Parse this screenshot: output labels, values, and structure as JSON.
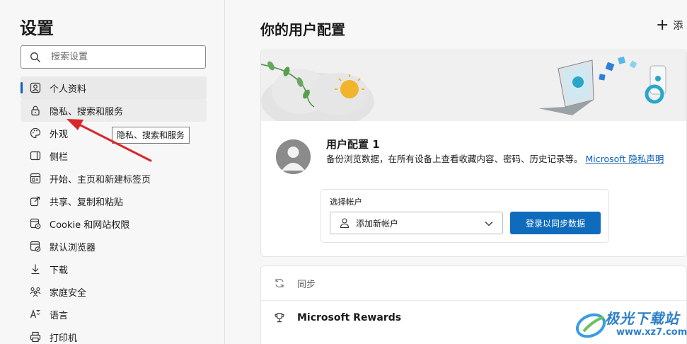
{
  "sidebar": {
    "title": "设置",
    "search_placeholder": "搜索设置",
    "items": [
      {
        "label": "个人资料",
        "icon": "profile-icon"
      },
      {
        "label": "隐私、搜索和服务",
        "icon": "lock-icon"
      },
      {
        "label": "外观",
        "icon": "palette-icon"
      },
      {
        "label": "侧栏",
        "icon": "sidebar-icon"
      },
      {
        "label": "开始、主页和新建标签页",
        "icon": "home-grid-icon"
      },
      {
        "label": "共享、复制和粘贴",
        "icon": "share-icon"
      },
      {
        "label": "Cookie 和网站权限",
        "icon": "cookie-icon"
      },
      {
        "label": "默认浏览器",
        "icon": "browser-icon"
      },
      {
        "label": "下载",
        "icon": "download-icon"
      },
      {
        "label": "家庭安全",
        "icon": "family-icon"
      },
      {
        "label": "语言",
        "icon": "language-icon"
      },
      {
        "label": "打印机",
        "icon": "printer-icon"
      }
    ],
    "tooltip": "隐私、搜索和服务"
  },
  "main": {
    "title": "你的用户配置",
    "add_label": "添",
    "profile": {
      "name": "用户配置 1",
      "description": "备份浏览数据，在所有设备上查看收藏内容、密码、历史记录等。",
      "link_text": "Microsoft 隐私声明",
      "account_label": "选择帐户",
      "account_value": "添加新帐户",
      "sync_button": "登录以同步数据"
    },
    "list": [
      {
        "label": "同步",
        "icon": "sync-icon"
      },
      {
        "label": "Microsoft Rewards",
        "icon": "trophy-icon"
      }
    ]
  },
  "watermark": {
    "text": "极光下载站",
    "url": "www.xz7.com"
  },
  "colors": {
    "accent": "#0f6cbd",
    "link": "#0f5fb5",
    "arrow": "#d9262b"
  }
}
